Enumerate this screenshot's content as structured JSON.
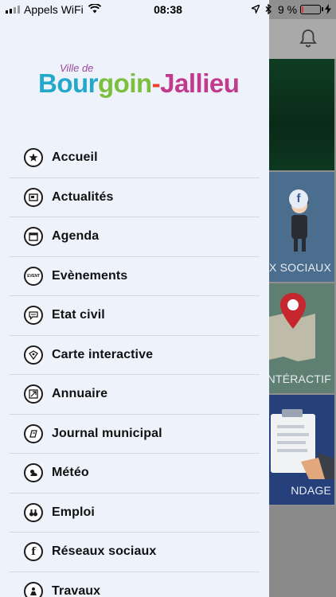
{
  "status_bar": {
    "carrier": "Appels WiFi",
    "time": "08:38",
    "battery_percent": "9 %",
    "battery_level": 0.09
  },
  "logo": {
    "small": "Ville de",
    "part1": "Bour",
    "part2": "goin",
    "sep": "-",
    "part3": "Jallieu"
  },
  "menu": {
    "items": [
      {
        "label": "Accueil",
        "icon": "star-icon"
      },
      {
        "label": "Actualités",
        "icon": "news-icon"
      },
      {
        "label": "Agenda",
        "icon": "calendar-icon"
      },
      {
        "label": "Evènements",
        "icon": "event-icon",
        "icon_text": "EVENT"
      },
      {
        "label": "Etat civil",
        "icon": "chat-bubble-icon"
      },
      {
        "label": "Carte interactive",
        "icon": "map-icon"
      },
      {
        "label": "Annuaire",
        "icon": "directory-icon"
      },
      {
        "label": "Journal municipal",
        "icon": "journal-icon"
      },
      {
        "label": "Météo",
        "icon": "weather-icon"
      },
      {
        "label": "Emploi",
        "icon": "binoculars-icon"
      },
      {
        "label": "Réseaux sociaux",
        "icon": "facebook-icon",
        "icon_text": "f"
      },
      {
        "label": "Travaux",
        "icon": "worker-icon"
      }
    ]
  },
  "background": {
    "tile_social_label": "UX SOCIAUX",
    "tile_map_label": "NTÉRACTIF",
    "tile_survey_label": "NDAGE",
    "colors": {
      "green_tile": "#0f3d22",
      "social_tile": "#4b6d8e",
      "map_tile": "#5f7f72",
      "survey_tile": "#25407a"
    }
  }
}
